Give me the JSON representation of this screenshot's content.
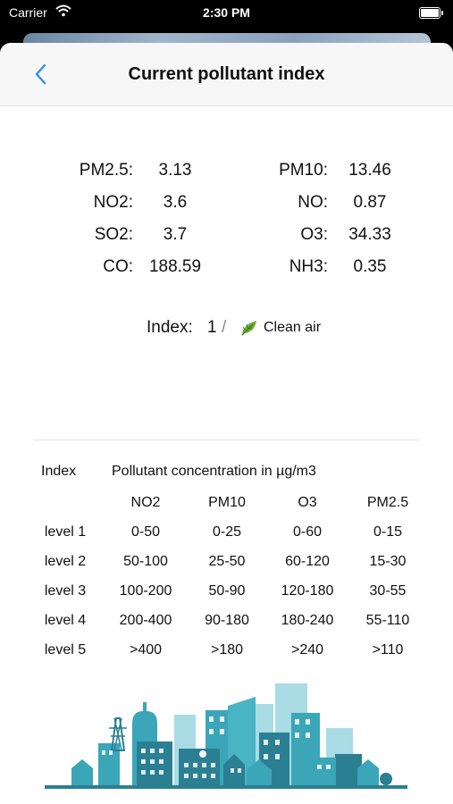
{
  "status_bar": {
    "carrier": "Carrier",
    "time": "2:30 PM"
  },
  "nav": {
    "title": "Current pollutant index"
  },
  "pollutants": {
    "left": [
      {
        "name": "PM2.5:",
        "value": "3.13"
      },
      {
        "name": "NO2:",
        "value": "3.6"
      },
      {
        "name": "SO2:",
        "value": "3.7"
      },
      {
        "name": "CO:",
        "value": "188.59"
      }
    ],
    "right": [
      {
        "name": "PM10:",
        "value": "13.46"
      },
      {
        "name": "NO:",
        "value": "0.87"
      },
      {
        "name": "O3:",
        "value": "34.33"
      },
      {
        "name": "NH3:",
        "value": "0.35"
      }
    ]
  },
  "index": {
    "label": "Index:",
    "value": "1",
    "separator": "/",
    "status": "Clean air",
    "icon": "leaf-icon"
  },
  "table": {
    "index_header": "Index",
    "concentration_header": "Pollutant concentration in µg/m3",
    "columns": [
      "NO2",
      "PM10",
      "O3",
      "PM2.5"
    ],
    "rows": [
      {
        "level": "level 1",
        "values": [
          "0-50",
          "0-25",
          "0-60",
          "0-15"
        ]
      },
      {
        "level": "level 2",
        "values": [
          "50-100",
          "25-50",
          "60-120",
          "15-30"
        ]
      },
      {
        "level": "level 3",
        "values": [
          "100-200",
          "50-90",
          "120-180",
          "30-55"
        ]
      },
      {
        "level": "level 4",
        "values": [
          "200-400",
          "90-180",
          "180-240",
          "55-110"
        ]
      },
      {
        "level": "level 5",
        "values": [
          ">400",
          ">180",
          ">240",
          ">110"
        ]
      }
    ]
  },
  "colors": {
    "accent": "#2f8ff0",
    "city_teal": "#3aa6b8",
    "city_dark": "#2b7f93",
    "city_light": "#a9dce4"
  }
}
